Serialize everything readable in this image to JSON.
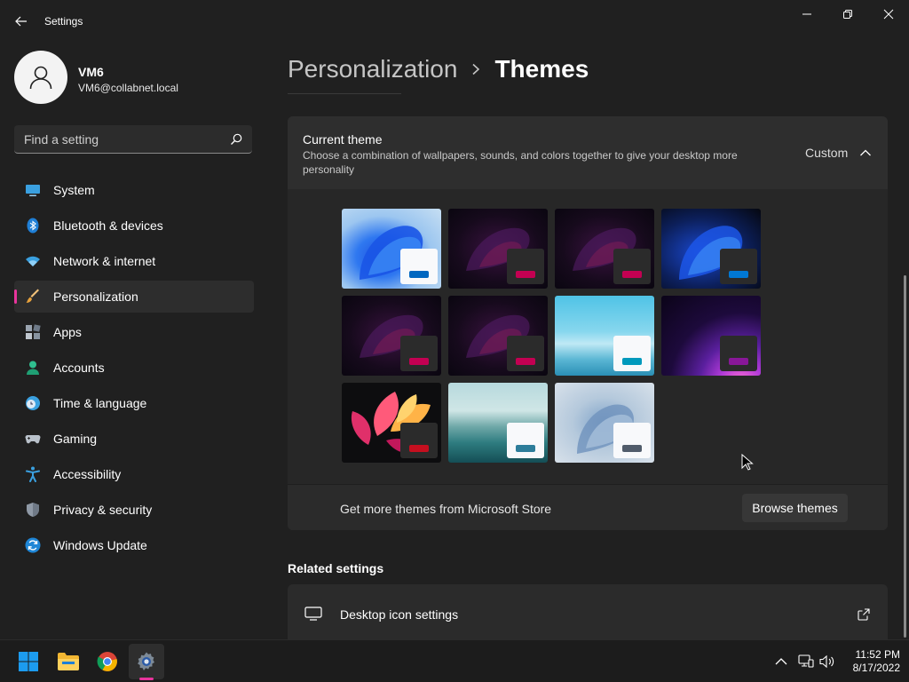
{
  "window": {
    "title": "Settings"
  },
  "profile": {
    "name": "VM6",
    "email": "VM6@collabnet.local"
  },
  "search": {
    "placeholder": "Find a setting"
  },
  "sidebar": {
    "items": [
      {
        "label": "System",
        "icon": "system-icon",
        "active": false
      },
      {
        "label": "Bluetooth & devices",
        "icon": "bluetooth-icon",
        "active": false
      },
      {
        "label": "Network & internet",
        "icon": "wifi-icon",
        "active": false
      },
      {
        "label": "Personalization",
        "icon": "brush-icon",
        "active": true
      },
      {
        "label": "Apps",
        "icon": "apps-icon",
        "active": false
      },
      {
        "label": "Accounts",
        "icon": "accounts-icon",
        "active": false
      },
      {
        "label": "Time & language",
        "icon": "clock-globe-icon",
        "active": false
      },
      {
        "label": "Gaming",
        "icon": "gamepad-icon",
        "active": false
      },
      {
        "label": "Accessibility",
        "icon": "accessibility-icon",
        "active": false
      },
      {
        "label": "Privacy & security",
        "icon": "shield-icon",
        "active": false
      },
      {
        "label": "Windows Update",
        "icon": "windows-update-icon",
        "active": false
      }
    ]
  },
  "breadcrumb": {
    "parent": "Personalization",
    "current": "Themes"
  },
  "current_theme": {
    "title": "Current theme",
    "description": "Choose a combination of wallpapers, sounds, and colors together to give your desktop more personality",
    "value": "Custom",
    "expanded": true,
    "themes": [
      {
        "name": "windows-light-bloom",
        "accent": "#0067c0",
        "swatch_light": true
      },
      {
        "name": "dark-bloom-1",
        "accent": "#c30052",
        "swatch_light": false
      },
      {
        "name": "dark-bloom-2",
        "accent": "#c30052",
        "swatch_light": false
      },
      {
        "name": "windows-dark-bloom",
        "accent": "#0078d4",
        "swatch_light": false
      },
      {
        "name": "dark-bloom-3",
        "accent": "#c30052",
        "swatch_light": false
      },
      {
        "name": "dark-bloom-4",
        "accent": "#c30052",
        "swatch_light": false
      },
      {
        "name": "glow",
        "accent": "#0099bc",
        "swatch_light": true
      },
      {
        "name": "captured-motion",
        "accent": "#881798",
        "swatch_light": false
      },
      {
        "name": "flow",
        "accent": "#c50f1f",
        "swatch_light": false
      },
      {
        "name": "sunrise",
        "accent": "#2d7d9a",
        "swatch_light": true
      },
      {
        "name": "light-bloom-grey",
        "accent": "#515c6b",
        "swatch_light": true
      }
    ]
  },
  "store": {
    "text": "Get more themes from Microsoft Store",
    "button": "Browse themes"
  },
  "related": {
    "heading": "Related settings",
    "items": [
      {
        "label": "Desktop icon settings",
        "icon": "monitor-icon"
      }
    ]
  },
  "taskbar": {
    "apps": [
      {
        "name": "start-button"
      },
      {
        "name": "file-explorer"
      },
      {
        "name": "chrome"
      },
      {
        "name": "settings",
        "active": true
      }
    ],
    "clock_time": "11:52 PM",
    "clock_date": "8/17/2022"
  },
  "colors": {
    "accent": "#e8349c",
    "background": "#202020",
    "card": "#2b2b2b"
  }
}
